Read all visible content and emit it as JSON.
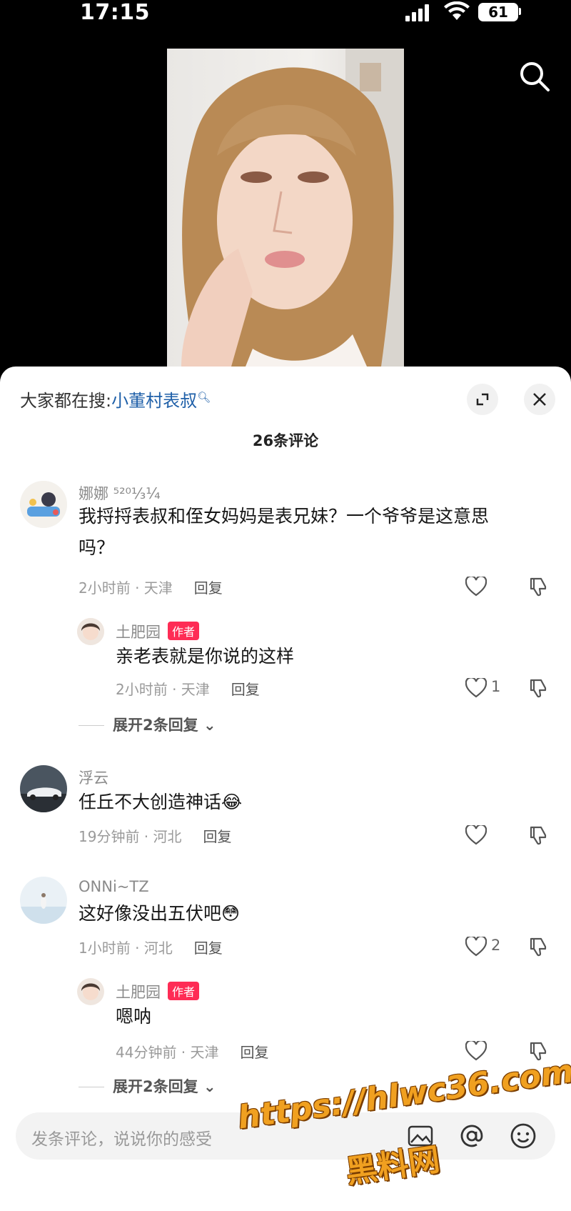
{
  "status_bar": {
    "time": "17:15",
    "battery": "61"
  },
  "trending": {
    "prefix": "大家都在搜:",
    "keyword": "小董村表叔"
  },
  "comment_count": "26条评论",
  "comments": [
    {
      "user": "娜娜 ⁵²⁰¹⁄₃¼",
      "text_line1": "我捋捋表叔和侄女妈妈是表兄妹？一个爷爷是这意思",
      "text_line2": "吗？",
      "time_location": "2小时前 · 天津",
      "reply_label": "回复",
      "likes": "",
      "replies": [
        {
          "user": "土肥园",
          "tag": "作者",
          "text": "亲老表就是你说的这样",
          "time_location": "2小时前 · 天津",
          "reply_label": "回复",
          "likes": "1"
        }
      ],
      "expand_label": "展开2条回复"
    },
    {
      "user": "浮云",
      "text": "任丘不大创造神话😂",
      "time_location": "19分钟前 · 河北",
      "reply_label": "回复",
      "likes": ""
    },
    {
      "user": "ONNi~TZ",
      "text": "这好像没出五伏吧😳",
      "time_location": "1小时前 · 河北",
      "reply_label": "回复",
      "likes": "2",
      "replies": [
        {
          "user": "土肥园",
          "tag": "作者",
          "text": "嗯呐",
          "time_location": "44分钟前 · 天津",
          "reply_label": "回复",
          "likes": ""
        }
      ],
      "expand_label": "展开2条回复"
    }
  ],
  "input": {
    "placeholder": "发条评论，说说你的感受"
  },
  "watermark": {
    "line1": "https://hlwc36.com",
    "line2": "黑料网"
  },
  "colors": {
    "author_tag": "#fe2c55",
    "keyword": "#1e5fa8",
    "watermark": "#f0a020"
  }
}
